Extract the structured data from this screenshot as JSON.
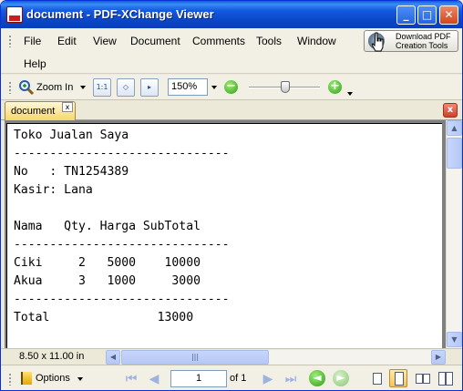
{
  "window": {
    "title": "document - PDF-XChange Viewer",
    "minimize_glyph": "_",
    "maximize_glyph": "□",
    "close_glyph": "✕"
  },
  "menu": {
    "items": [
      "File",
      "Edit",
      "View",
      "Document",
      "Comments",
      "Tools",
      "Window"
    ],
    "help": "Help",
    "download_line1": "Download PDF",
    "download_line2": "Creation Tools"
  },
  "toolbar": {
    "zoom_in_label": "Zoom In",
    "zoom_value": "150%",
    "zoom_out_glyph": "−",
    "zoom_plus_glyph": "+"
  },
  "tabs": {
    "document_tab": "document",
    "tab_close_glyph": "x",
    "panel_close_glyph": "x"
  },
  "document": {
    "lines": [
      "Toko Jualan Saya",
      "------------------------------",
      "No   : TN1254389",
      "Kasir: Lana",
      "",
      "Nama   Qty. Harga SubTotal",
      "------------------------------",
      "Ciki     2   5000    10000",
      "Akua     3   1000     3000",
      "------------------------------",
      "Total               13000"
    ]
  },
  "status": {
    "page_size": "8.50 x 11.00 in",
    "current_page": "1",
    "page_count_text": "of 1",
    "options_label": "Options"
  },
  "icons": {
    "app": "pdf-icon",
    "zoom": "magnifier-icon",
    "options": "flag-icon"
  },
  "colors": {
    "titlebar": "#0b47c9",
    "tab_active": "#f6d76a",
    "zoom_button": "#2e9a14",
    "close_button": "#d2451b"
  }
}
